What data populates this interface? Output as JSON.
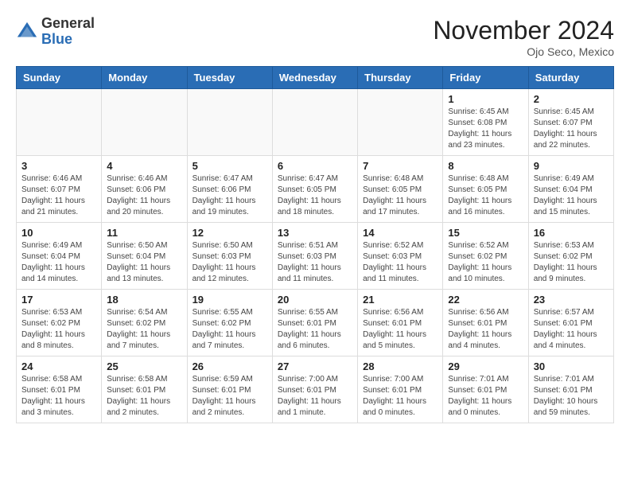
{
  "header": {
    "logo_line1": "General",
    "logo_line2": "Blue",
    "month": "November 2024",
    "location": "Ojo Seco, Mexico"
  },
  "weekdays": [
    "Sunday",
    "Monday",
    "Tuesday",
    "Wednesday",
    "Thursday",
    "Friday",
    "Saturday"
  ],
  "weeks": [
    [
      {
        "day": "",
        "info": ""
      },
      {
        "day": "",
        "info": ""
      },
      {
        "day": "",
        "info": ""
      },
      {
        "day": "",
        "info": ""
      },
      {
        "day": "",
        "info": ""
      },
      {
        "day": "1",
        "info": "Sunrise: 6:45 AM\nSunset: 6:08 PM\nDaylight: 11 hours\nand 23 minutes."
      },
      {
        "day": "2",
        "info": "Sunrise: 6:45 AM\nSunset: 6:07 PM\nDaylight: 11 hours\nand 22 minutes."
      }
    ],
    [
      {
        "day": "3",
        "info": "Sunrise: 6:46 AM\nSunset: 6:07 PM\nDaylight: 11 hours\nand 21 minutes."
      },
      {
        "day": "4",
        "info": "Sunrise: 6:46 AM\nSunset: 6:06 PM\nDaylight: 11 hours\nand 20 minutes."
      },
      {
        "day": "5",
        "info": "Sunrise: 6:47 AM\nSunset: 6:06 PM\nDaylight: 11 hours\nand 19 minutes."
      },
      {
        "day": "6",
        "info": "Sunrise: 6:47 AM\nSunset: 6:05 PM\nDaylight: 11 hours\nand 18 minutes."
      },
      {
        "day": "7",
        "info": "Sunrise: 6:48 AM\nSunset: 6:05 PM\nDaylight: 11 hours\nand 17 minutes."
      },
      {
        "day": "8",
        "info": "Sunrise: 6:48 AM\nSunset: 6:05 PM\nDaylight: 11 hours\nand 16 minutes."
      },
      {
        "day": "9",
        "info": "Sunrise: 6:49 AM\nSunset: 6:04 PM\nDaylight: 11 hours\nand 15 minutes."
      }
    ],
    [
      {
        "day": "10",
        "info": "Sunrise: 6:49 AM\nSunset: 6:04 PM\nDaylight: 11 hours\nand 14 minutes."
      },
      {
        "day": "11",
        "info": "Sunrise: 6:50 AM\nSunset: 6:04 PM\nDaylight: 11 hours\nand 13 minutes."
      },
      {
        "day": "12",
        "info": "Sunrise: 6:50 AM\nSunset: 6:03 PM\nDaylight: 11 hours\nand 12 minutes."
      },
      {
        "day": "13",
        "info": "Sunrise: 6:51 AM\nSunset: 6:03 PM\nDaylight: 11 hours\nand 11 minutes."
      },
      {
        "day": "14",
        "info": "Sunrise: 6:52 AM\nSunset: 6:03 PM\nDaylight: 11 hours\nand 11 minutes."
      },
      {
        "day": "15",
        "info": "Sunrise: 6:52 AM\nSunset: 6:02 PM\nDaylight: 11 hours\nand 10 minutes."
      },
      {
        "day": "16",
        "info": "Sunrise: 6:53 AM\nSunset: 6:02 PM\nDaylight: 11 hours\nand 9 minutes."
      }
    ],
    [
      {
        "day": "17",
        "info": "Sunrise: 6:53 AM\nSunset: 6:02 PM\nDaylight: 11 hours\nand 8 minutes."
      },
      {
        "day": "18",
        "info": "Sunrise: 6:54 AM\nSunset: 6:02 PM\nDaylight: 11 hours\nand 7 minutes."
      },
      {
        "day": "19",
        "info": "Sunrise: 6:55 AM\nSunset: 6:02 PM\nDaylight: 11 hours\nand 7 minutes."
      },
      {
        "day": "20",
        "info": "Sunrise: 6:55 AM\nSunset: 6:01 PM\nDaylight: 11 hours\nand 6 minutes."
      },
      {
        "day": "21",
        "info": "Sunrise: 6:56 AM\nSunset: 6:01 PM\nDaylight: 11 hours\nand 5 minutes."
      },
      {
        "day": "22",
        "info": "Sunrise: 6:56 AM\nSunset: 6:01 PM\nDaylight: 11 hours\nand 4 minutes."
      },
      {
        "day": "23",
        "info": "Sunrise: 6:57 AM\nSunset: 6:01 PM\nDaylight: 11 hours\nand 4 minutes."
      }
    ],
    [
      {
        "day": "24",
        "info": "Sunrise: 6:58 AM\nSunset: 6:01 PM\nDaylight: 11 hours\nand 3 minutes."
      },
      {
        "day": "25",
        "info": "Sunrise: 6:58 AM\nSunset: 6:01 PM\nDaylight: 11 hours\nand 2 minutes."
      },
      {
        "day": "26",
        "info": "Sunrise: 6:59 AM\nSunset: 6:01 PM\nDaylight: 11 hours\nand 2 minutes."
      },
      {
        "day": "27",
        "info": "Sunrise: 7:00 AM\nSunset: 6:01 PM\nDaylight: 11 hours\nand 1 minute."
      },
      {
        "day": "28",
        "info": "Sunrise: 7:00 AM\nSunset: 6:01 PM\nDaylight: 11 hours\nand 0 minutes."
      },
      {
        "day": "29",
        "info": "Sunrise: 7:01 AM\nSunset: 6:01 PM\nDaylight: 11 hours\nand 0 minutes."
      },
      {
        "day": "30",
        "info": "Sunrise: 7:01 AM\nSunset: 6:01 PM\nDaylight: 10 hours\nand 59 minutes."
      }
    ]
  ]
}
